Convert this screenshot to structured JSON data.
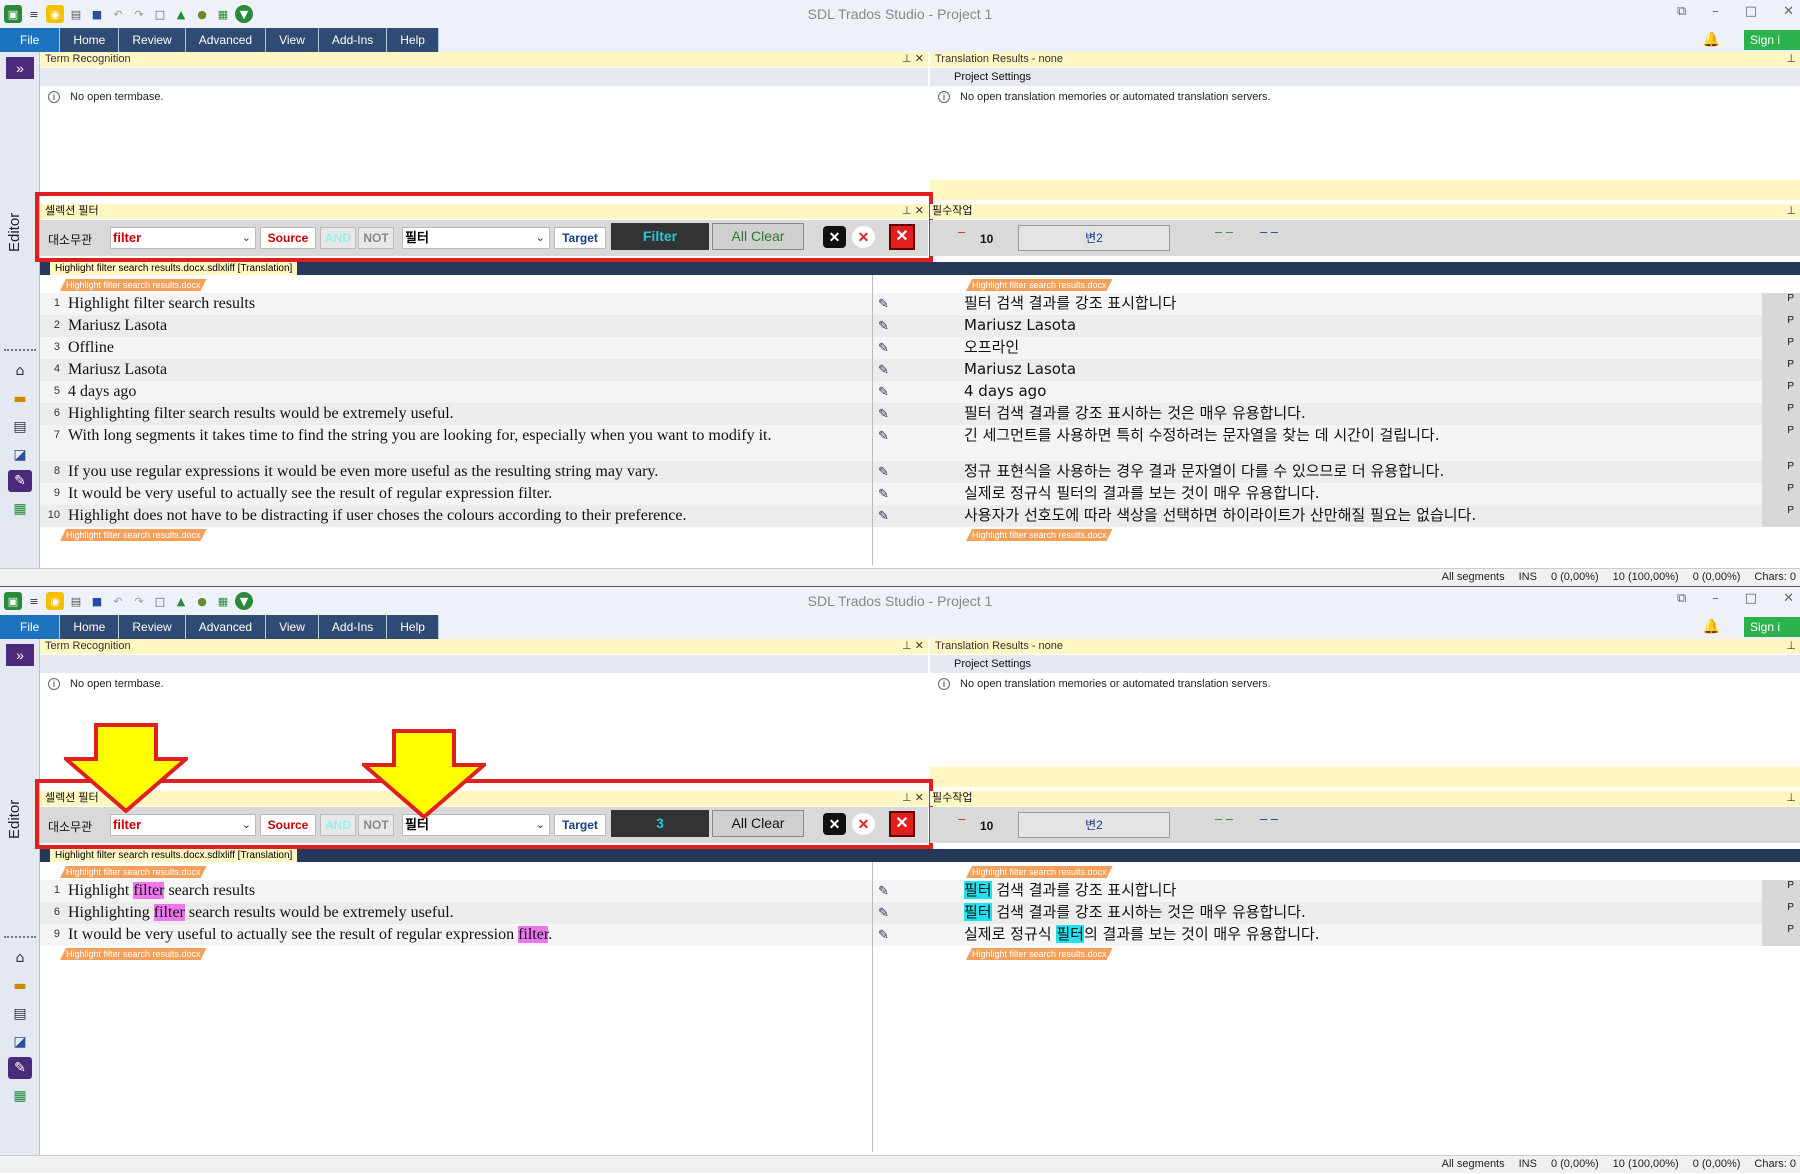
{
  "app": {
    "title": "SDL Trados Studio - Project 1",
    "menu": [
      "File",
      "Home",
      "Review",
      "Advanced",
      "View",
      "Add-Ins",
      "Help"
    ],
    "sign_in": "Sign i",
    "side_label": "Editor",
    "expand_symbol": "»"
  },
  "term_recognition": {
    "title": "Term Recognition",
    "message": "No open termbase."
  },
  "translation_results": {
    "title": "Translation Results - none",
    "project_settings": "Project Settings",
    "message": "No open translation memories or automated translation servers."
  },
  "filter_panel": {
    "title": "셀렉션 필터",
    "case_label": "대소무관",
    "source_value": "filter",
    "source_btn": "Source",
    "and_btn": "AND",
    "not_btn": "NOT",
    "target_value": "필터",
    "target_btn": "Target",
    "filter_btn_top": "Filter",
    "filter_btn_bottom": "3",
    "all_clear": "All Clear"
  },
  "required_panel": {
    "title": "필수작업",
    "count": "10",
    "var_btn": "변2"
  },
  "document": {
    "banner": "Highlight filter search results.docx.sdlxliff [Translation]",
    "tag": "Highlight filter search results.docx"
  },
  "segments_top": [
    {
      "n": "1",
      "src": "Highlight filter search results",
      "tgt": "필터 검색 결과를 강조 표시합니다"
    },
    {
      "n": "2",
      "src": "Mariusz Lasota",
      "tgt": "Mariusz Lasota"
    },
    {
      "n": "3",
      "src": "Offline",
      "tgt": "오프라인"
    },
    {
      "n": "4",
      "src": "Mariusz Lasota",
      "tgt": "Mariusz Lasota"
    },
    {
      "n": "5",
      "src": "4 days ago",
      "tgt": "4 days ago"
    },
    {
      "n": "6",
      "src": "Highlighting filter search results would be extremely useful.",
      "tgt": "필터 검색 결과를 강조 표시하는 것은 매우 유용합니다."
    },
    {
      "n": "7",
      "src": "With long segments it takes time to find the string you are looking for, especially when you want to modify it.",
      "tgt": "긴 세그먼트를 사용하면 특히 수정하려는 문자열을 찾는 데 시간이 걸립니다."
    },
    {
      "n": "8",
      "src": "If you use regular expressions it would be even more useful as the resulting string may vary.",
      "tgt": "정규 표현식을 사용하는 경우 결과 문자열이 다를 수 있으므로 더 유용합니다."
    },
    {
      "n": "9",
      "src": "It would be very useful to actually see the result of regular expression filter.",
      "tgt": "실제로 정규식 필터의 결과를 보는 것이 매우 유용합니다."
    },
    {
      "n": "10",
      "src": "Highlight does not have to be distracting if user choses the colours according to their preference.",
      "tgt": "사용자가 선호도에 따라 색상을 선택하면 하이라이트가 산만해질 필요는 없습니다."
    }
  ],
  "segments_bottom": [
    {
      "n": "1",
      "src_pre": "Highlight ",
      "src_hl": "filter",
      "src_post": " search results",
      "tgt_pre": "",
      "tgt_hl": "필터",
      "tgt_post": " 검색 결과를 강조 표시합니다"
    },
    {
      "n": "6",
      "src_pre": "Highlighting ",
      "src_hl": "filter",
      "src_post": " search results would be extremely useful.",
      "tgt_pre": "",
      "tgt_hl": "필터",
      "tgt_post": " 검색 결과를 강조 표시하는 것은 매우 유용합니다."
    },
    {
      "n": "9",
      "src_pre": "It would be very useful to actually see the result of regular expression ",
      "src_hl": "filter",
      "src_post": ".",
      "tgt_pre": "실제로 정규식 ",
      "tgt_hl": "필터",
      "tgt_post": "의 결과를 보는 것이 매우 유용합니다."
    }
  ],
  "status": {
    "segments": "All segments",
    "ins": "INS",
    "s1": "0 (0,00%)",
    "s2": "10 (100,00%)",
    "s3": "0 (0,00%)",
    "chars": "Chars: 0"
  },
  "colors": {
    "accent": "#2f4a73",
    "highlight_red": "#e02020",
    "source_highlight": "#ee77ee",
    "target_highlight": "#22e0ee",
    "arrow": "#ffff00"
  }
}
